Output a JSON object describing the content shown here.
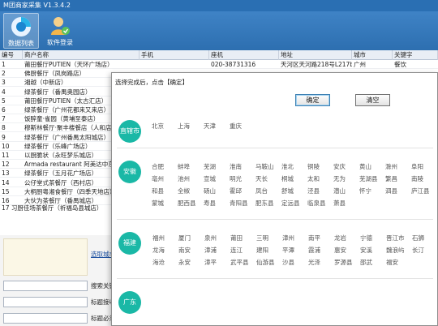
{
  "app": {
    "title": "M团商家采集 V1.3.4.2"
  },
  "toolbar": {
    "items": [
      {
        "label": "数据列表"
      },
      {
        "label": "软件登录"
      }
    ]
  },
  "table": {
    "columns": [
      "编号",
      "商户名称",
      "手机",
      "座机",
      "地址",
      "城市",
      "关键字"
    ],
    "rows": [
      {
        "id": "1",
        "name": "莆田餐厅PUTIEN（天环广场店）",
        "phone": "",
        "tel": "020-38731316",
        "address": "天河区天河路218号L217b(东海楼附近)",
        "city": "广州",
        "keyword": "餐饮"
      },
      {
        "id": "2",
        "name": "佛厨餐厅（凤岗路店）",
        "phone": "",
        "tel": "",
        "address": "",
        "city": "",
        "keyword": ""
      },
      {
        "id": "3",
        "name": "湘越（中新店）",
        "phone": "",
        "tel": "",
        "address": "",
        "city": "",
        "keyword": ""
      },
      {
        "id": "4",
        "name": "绿茶餐厅（番禺奥园店）",
        "phone": "",
        "tel": "",
        "address": "",
        "city": "",
        "keyword": ""
      },
      {
        "id": "5",
        "name": "莆田餐厅PUTIEN（太古汇店）",
        "phone": "",
        "tel": "",
        "address": "",
        "city": "",
        "keyword": ""
      },
      {
        "id": "6",
        "name": "绿茶餐厅（广州花都来又来店）",
        "phone": "",
        "tel": "",
        "address": "",
        "city": "",
        "keyword": ""
      },
      {
        "id": "7",
        "name": "饭醉童·雀园（黄埔至泰店）",
        "phone": "",
        "tel": "",
        "address": "",
        "city": "",
        "keyword": ""
      },
      {
        "id": "8",
        "name": "穆斯林餐厅·聚丰楼餐店（人和店）",
        "phone": "",
        "tel": "",
        "address": "",
        "city": "",
        "keyword": ""
      },
      {
        "id": "9",
        "name": "绿茶餐厅（广州番禺太阳城店）",
        "phone": "",
        "tel": "",
        "address": "",
        "city": "",
        "keyword": ""
      },
      {
        "id": "10",
        "name": "绿茶餐厅（乐峰广场店）",
        "phone": "",
        "tel": "",
        "address": "",
        "city": "",
        "keyword": ""
      },
      {
        "id": "11",
        "name": "以厨脆状（永旺梦乐城店）",
        "phone": "",
        "tel": "",
        "address": "",
        "city": "",
        "keyword": ""
      },
      {
        "id": "12",
        "name": "Armada restaurant 阿美达中东料理",
        "phone": "",
        "tel": "",
        "address": "",
        "city": "",
        "keyword": ""
      },
      {
        "id": "13",
        "name": "绿茶餐厅（五月花广场店）",
        "phone": "",
        "tel": "",
        "address": "",
        "city": "",
        "keyword": ""
      },
      {
        "id": "14",
        "name": "公仔堂式茶餐厅（西村店）",
        "phone": "",
        "tel": "",
        "address": "",
        "city": "",
        "keyword": ""
      },
      {
        "id": "15",
        "name": "大桐厨粤湘食餐厅（四季天地店）",
        "phone": "",
        "tel": "",
        "address": "",
        "city": "",
        "keyword": ""
      },
      {
        "id": "16",
        "name": "大伙为茶餐厅（番禺城店）",
        "phone": "",
        "tel": "",
        "address": "",
        "city": "",
        "keyword": ""
      }
    ],
    "partial_row": "17  习厨佳场茶餐厅（祈福岛县城店）"
  },
  "lower": {
    "link_text": "选取城市",
    "labels": [
      "搜索关键",
      "标题接收",
      "标题必须"
    ]
  },
  "dialog": {
    "hint": "选择完成后，点击【确定】",
    "ok_label": "确定",
    "clear_label": "清空",
    "regions": [
      {
        "name": "直辖市",
        "rows": [
          [
            "北京",
            "上海",
            "天津",
            "重庆"
          ]
        ]
      },
      {
        "name": "安徽",
        "rows": [
          [
            "合肥",
            "蚌埠",
            "芜湖",
            "淮南",
            "马鞍山",
            "淮北",
            "铜陵",
            "安庆",
            "黄山",
            "滁州",
            "阜阳"
          ],
          [
            "亳州",
            "池州",
            "宣城",
            "明光",
            "天长",
            "桐城",
            "太和",
            "无为",
            "芜湖县",
            "繁昌",
            "南陵"
          ],
          [
            "和县",
            "全椒",
            "砀山",
            "霍邱",
            "凤台",
            "舒城",
            "泾县",
            "潜山",
            "怀宁",
            "泗县",
            "庐江县"
          ],
          [
            "蒙城",
            "肥西县",
            "寿县",
            "青阳县",
            "肥东县",
            "定远县",
            "临泉县",
            "萧县"
          ]
        ]
      },
      {
        "name": "福建",
        "rows": [
          [
            "福州",
            "厦门",
            "泉州",
            "莆田",
            "三明",
            "漳州",
            "南平",
            "龙岩",
            "宁德",
            "晋江市",
            "石狮"
          ],
          [
            "龙海",
            "南安",
            "漳浦",
            "连江",
            "建阳",
            "平潭",
            "霞浦",
            "惠安",
            "安溪",
            "魏浪屿",
            "长汀"
          ],
          [
            "海沧",
            "永安",
            "漳平",
            "武平县",
            "仙游县",
            "沙县",
            "光泽",
            "罗源县",
            "邵武",
            "福安"
          ]
        ]
      },
      {
        "name": "广东",
        "rows": []
      }
    ]
  },
  "colors": {
    "titlebar": "#2a6fb3",
    "badge": "#1ab8a6"
  }
}
